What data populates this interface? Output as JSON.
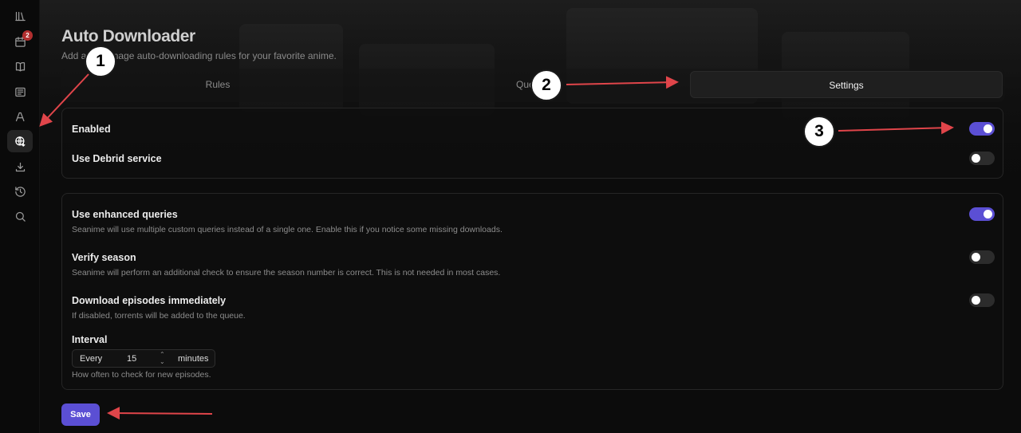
{
  "sidebar": {
    "items": [
      {
        "name": "library-icon"
      },
      {
        "name": "calendar-icon",
        "badge": "2"
      },
      {
        "name": "book-icon"
      },
      {
        "name": "news-icon"
      },
      {
        "name": "anilist-icon"
      },
      {
        "name": "globe-download-icon",
        "active": true
      },
      {
        "name": "download-icon"
      },
      {
        "name": "history-icon"
      },
      {
        "name": "search-icon"
      }
    ]
  },
  "header": {
    "title": "Auto Downloader",
    "subtitle": "Add and manage auto-downloading rules for your favorite anime."
  },
  "tabs": [
    {
      "label": "Rules",
      "active": false
    },
    {
      "label": "Queue",
      "active": false
    },
    {
      "label": "Settings",
      "active": true
    }
  ],
  "general_settings": {
    "enabled": {
      "label": "Enabled",
      "value": true
    },
    "debrid": {
      "label": "Use Debrid service",
      "value": false
    }
  },
  "advanced_settings": {
    "enhanced_queries": {
      "label": "Use enhanced queries",
      "help": "Seanime will use multiple custom queries instead of a single one. Enable this if you notice some missing downloads.",
      "value": true
    },
    "verify_season": {
      "label": "Verify season",
      "help": "Seanime will perform an additional check to ensure the season number is correct. This is not needed in most cases.",
      "value": false
    },
    "download_immediately": {
      "label": "Download episodes immediately",
      "help": "If disabled, torrents will be added to the queue.",
      "value": false
    },
    "interval": {
      "label": "Interval",
      "prefix": "Every",
      "value": "15",
      "suffix": "minutes",
      "help": "How often to check for new episodes."
    }
  },
  "save_label": "Save",
  "annotations": {
    "step1": "1",
    "step2": "2",
    "step3": "3"
  },
  "colors": {
    "accent": "#5b4fd4",
    "arrow": "#e0454a",
    "badge": "#b22f2f"
  }
}
